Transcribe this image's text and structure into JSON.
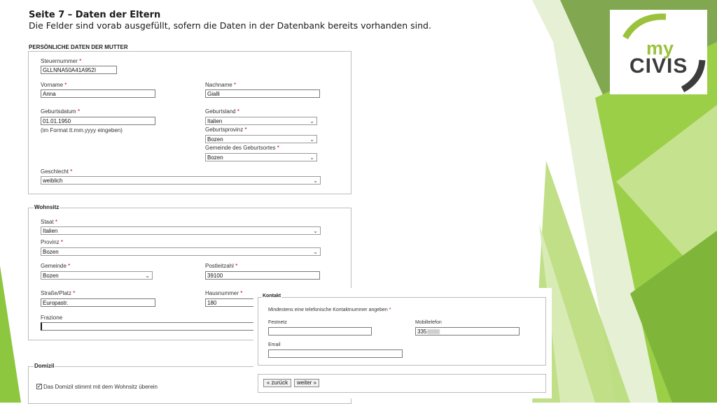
{
  "slide": {
    "title": "Seite 7 – Daten der Eltern",
    "subtitle": "Die Felder sind vorab ausgefüllt, sofern die Daten in der Datenbank bereits vorhanden sind."
  },
  "logo": {
    "line1": "my",
    "line2": "CIVIS"
  },
  "mother": {
    "section_title": "PERSÖNLICHE DATEN DER MUTTER",
    "tax_label": "Steuernummer",
    "tax_value": "GLLNNA50A41A952I",
    "firstname_label": "Vorname",
    "firstname_value": "Anna",
    "lastname_label": "Nachname",
    "lastname_value": "Gialli",
    "birthdate_label": "Geburtsdatum",
    "birthdate_value": "01.01.1950",
    "birthdate_hint": "(im Format tt.mm.yyyy eingeben)",
    "birthcountry_label": "Geburtsland",
    "birthcountry_value": "Italien",
    "birthprovince_label": "Geburtsprovinz",
    "birthprovince_value": "Bozen",
    "birthtown_label": "Gemeinde des Geburtsortes",
    "birthtown_value": "Bozen",
    "gender_label": "Geschlecht",
    "gender_value": "weiblich"
  },
  "residence": {
    "section_title": "Wohnsitz",
    "state_label": "Staat",
    "state_value": "Italien",
    "province_label": "Provinz",
    "province_value": "Bozen",
    "municipality_label": "Gemeinde",
    "municipality_value": "Bozen",
    "zip_label": "Postleitzahl",
    "zip_value": "39100",
    "street_label": "Straße/Platz",
    "street_value": "Europastr.",
    "housenr_label": "Hausnummer",
    "housenr_value": "180",
    "fraction_label": "Frazione",
    "fraction_value": ""
  },
  "domicile": {
    "section_title": "Domizil",
    "same_label": "Das Domizil stimmt mit dem Wohnsitz überein",
    "same_checked": "✓"
  },
  "contact": {
    "section_title": "Kontakt",
    "note": "Mindestens eine telefonische Kontaktnummer angeben",
    "landline_label": "Festnetz",
    "landline_value": "",
    "mobile_label": "Mobiltelefon",
    "mobile_value": "335",
    "email_label": "Email",
    "email_value": ""
  },
  "nav": {
    "back": "« zurück",
    "next": "weiter »"
  },
  "required_mark": "*",
  "chevron": "⌄",
  "colors": {
    "accent_green": "#8dc63f",
    "required": "#c00000"
  }
}
